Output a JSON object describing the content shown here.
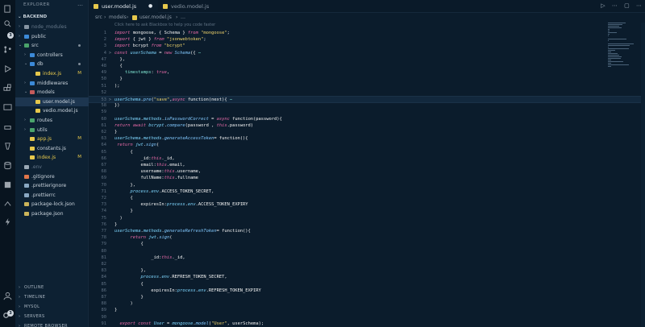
{
  "sidebar": {
    "title": "EXPLORER",
    "title_menu": "…",
    "root": "BACKEND",
    "tree": [
      {
        "label": "node_modules",
        "kind": "folder",
        "depth": 1,
        "chev": "›",
        "color": "gray",
        "dim": true
      },
      {
        "label": "public",
        "kind": "folder",
        "depth": 1,
        "chev": "›",
        "color": "blue"
      },
      {
        "label": "src",
        "kind": "folder",
        "depth": 1,
        "chev": "⌄",
        "color": "green",
        "dot": true
      },
      {
        "label": "controllers",
        "kind": "folder",
        "depth": 2,
        "chev": "›",
        "color": "blue"
      },
      {
        "label": "db",
        "kind": "folder",
        "depth": 2,
        "chev": "⌄",
        "color": "blue",
        "dot": true
      },
      {
        "label": "index.js",
        "kind": "js",
        "depth": 3,
        "mark": "M"
      },
      {
        "label": "middlewares",
        "kind": "folder",
        "depth": 2,
        "chev": "›",
        "color": "blue"
      },
      {
        "label": "models",
        "kind": "folder",
        "depth": 2,
        "chev": "⌄",
        "color": "red"
      },
      {
        "label": "user.model.js",
        "kind": "js",
        "depth": 3,
        "selected": true
      },
      {
        "label": "vedio.model.js",
        "kind": "js",
        "depth": 3
      },
      {
        "label": "routes",
        "kind": "folder",
        "depth": 2,
        "chev": "›",
        "color": "green"
      },
      {
        "label": "utils",
        "kind": "folder",
        "depth": 2,
        "chev": "›",
        "color": "green"
      },
      {
        "label": "app.js",
        "kind": "js",
        "depth": 2,
        "mark": "M"
      },
      {
        "label": "constants.js",
        "kind": "js",
        "depth": 2
      },
      {
        "label": "index.js",
        "kind": "js",
        "depth": 2,
        "mark": "M"
      },
      {
        "label": ".env",
        "kind": "txt",
        "depth": 1,
        "dim": true
      },
      {
        "label": ".gitignore",
        "kind": "git",
        "depth": 1
      },
      {
        "label": ".prettierignore",
        "kind": "prettier",
        "depth": 1
      },
      {
        "label": ".prettierrc",
        "kind": "prettier",
        "depth": 1
      },
      {
        "label": "package-lock.json",
        "kind": "json",
        "depth": 1
      },
      {
        "label": "package.json",
        "kind": "json",
        "depth": 1
      }
    ],
    "panels": [
      "OUTLINE",
      "TIMELINE",
      "MYSQL",
      "SERVERS",
      "REMOTE BROWSER"
    ]
  },
  "tabs": [
    {
      "label": "user.model.js",
      "active": true,
      "marker": "●"
    },
    {
      "label": "vedio.model.js",
      "active": false
    }
  ],
  "editor_actions": [
    "▷",
    "⋯",
    "▢",
    "⋯"
  ],
  "breadcrumb": [
    "src",
    "›",
    "models",
    "›",
    "user.model.js",
    "›",
    "…"
  ],
  "ai_hint": "Click here to ask Blackbox to help you code faster",
  "lines": [
    {
      "n": "1",
      "t": [
        [
          "k",
          "import "
        ],
        [
          "p",
          "mongoose, { Schema } "
        ],
        [
          "k",
          "from "
        ],
        [
          "s",
          "\"mongoose\""
        ],
        [
          "p",
          ";"
        ]
      ]
    },
    {
      "n": "2",
      "t": [
        [
          "k",
          "import "
        ],
        [
          "p",
          "{ jwt } "
        ],
        [
          "k",
          "from "
        ],
        [
          "s",
          "\"jsonwebtoken\""
        ],
        [
          "p",
          ";"
        ]
      ]
    },
    {
      "n": "3",
      "t": [
        [
          "k",
          "import "
        ],
        [
          "p",
          "bcrypt "
        ],
        [
          "k",
          "from "
        ],
        [
          "s",
          "\"bcrypt\""
        ]
      ]
    },
    {
      "n": "4",
      "fold": ">",
      "t": [
        [
          "k",
          "const "
        ],
        [
          "v",
          "userSchema "
        ],
        [
          "p",
          "= "
        ],
        [
          "k",
          "new "
        ],
        [
          "fn",
          "Schema"
        ],
        [
          "p",
          "({"
        ],
        [
          "c",
          " ⋯"
        ]
      ]
    },
    {
      "n": "47",
      "t": [
        [
          "p",
          "  },"
        ]
      ]
    },
    {
      "n": "48",
      "t": [
        [
          "p",
          "  {"
        ]
      ]
    },
    {
      "n": "49",
      "t": [
        [
          "c",
          "    timestamps"
        ],
        [
          "p",
          ": "
        ],
        [
          "k",
          "true"
        ],
        [
          "p",
          ","
        ]
      ]
    },
    {
      "n": "50",
      "t": [
        [
          "p",
          "  }"
        ]
      ]
    },
    {
      "n": "51",
      "t": [
        [
          "p",
          ");"
        ]
      ]
    },
    {
      "n": "52",
      "t": []
    },
    {
      "n": "53",
      "fold": ">",
      "hl": true,
      "t": [
        [
          "v",
          "userSchema"
        ],
        [
          "p",
          "."
        ],
        [
          "fn",
          "pre"
        ],
        [
          "p",
          "("
        ],
        [
          "s",
          "\"save\""
        ],
        [
          "p",
          ","
        ],
        [
          "k",
          "async "
        ],
        [
          "p",
          "function(next){"
        ],
        [
          "c",
          " ⋯"
        ]
      ]
    },
    {
      "n": "58",
      "t": [
        [
          "p",
          "})"
        ]
      ]
    },
    {
      "n": "59",
      "t": []
    },
    {
      "n": "60",
      "t": [
        [
          "v",
          "userSchema"
        ],
        [
          "p",
          "."
        ],
        [
          "v",
          "methods"
        ],
        [
          "p",
          "."
        ],
        [
          "fn",
          "isPasswordCorrect "
        ],
        [
          "p",
          "= "
        ],
        [
          "k",
          "async "
        ],
        [
          "p",
          "function(password){"
        ]
      ]
    },
    {
      "n": "61",
      "t": [
        [
          "k",
          "return "
        ],
        [
          "k",
          "await "
        ],
        [
          "v",
          "bcrypt"
        ],
        [
          "p",
          "."
        ],
        [
          "fn",
          "compare"
        ],
        [
          "p",
          "(password , "
        ],
        [
          "k",
          "this"
        ],
        [
          "p",
          ".password)"
        ]
      ]
    },
    {
      "n": "62",
      "t": [
        [
          "p",
          "}"
        ]
      ]
    },
    {
      "n": "63",
      "t": [
        [
          "v",
          "userSchema"
        ],
        [
          "p",
          "."
        ],
        [
          "v",
          "methods"
        ],
        [
          "p",
          "."
        ],
        [
          "fn",
          "generateAccessToken"
        ],
        [
          "p",
          "= function(){"
        ]
      ]
    },
    {
      "n": "64",
      "t": [
        [
          "k",
          " return "
        ],
        [
          "v",
          "jwt"
        ],
        [
          "p",
          "."
        ],
        [
          "fn",
          "sign"
        ],
        [
          "p",
          "("
        ]
      ]
    },
    {
      "n": "65",
      "t": [
        [
          "p",
          "      {"
        ]
      ]
    },
    {
      "n": "66",
      "t": [
        [
          "p",
          "          _id:"
        ],
        [
          "k",
          "this"
        ],
        [
          "p",
          "._id,"
        ]
      ]
    },
    {
      "n": "67",
      "t": [
        [
          "p",
          "          email:"
        ],
        [
          "k",
          "this"
        ],
        [
          "p",
          ".email,"
        ]
      ]
    },
    {
      "n": "68",
      "t": [
        [
          "p",
          "          username:"
        ],
        [
          "k",
          "this"
        ],
        [
          "p",
          ".username,"
        ]
      ]
    },
    {
      "n": "69",
      "t": [
        [
          "p",
          "          fullName:"
        ],
        [
          "k",
          "this"
        ],
        [
          "p",
          ".fullname"
        ]
      ]
    },
    {
      "n": "70",
      "t": [
        [
          "p",
          "      },"
        ]
      ]
    },
    {
      "n": "71",
      "t": [
        [
          "v",
          "      process"
        ],
        [
          "p",
          "."
        ],
        [
          "v",
          "env"
        ],
        [
          "p",
          ".ACCESS_TOKEN_SECRET,"
        ]
      ]
    },
    {
      "n": "72",
      "t": [
        [
          "p",
          "      {"
        ]
      ]
    },
    {
      "n": "73",
      "t": [
        [
          "p",
          "          expiresIn:"
        ],
        [
          "v",
          "process"
        ],
        [
          "p",
          "."
        ],
        [
          "v",
          "env"
        ],
        [
          "p",
          ".ACCESS_TOKEN_EXPIRY"
        ]
      ]
    },
    {
      "n": "74",
      "t": [
        [
          "p",
          "      }"
        ]
      ]
    },
    {
      "n": "75",
      "t": [
        [
          "p",
          "  )"
        ]
      ]
    },
    {
      "n": "76",
      "t": [
        [
          "p",
          "}"
        ]
      ]
    },
    {
      "n": "77",
      "t": [
        [
          "v",
          "userSchema"
        ],
        [
          "p",
          "."
        ],
        [
          "v",
          "methods"
        ],
        [
          "p",
          "."
        ],
        [
          "fn",
          "generateRefreshToken"
        ],
        [
          "p",
          "= function(){"
        ]
      ]
    },
    {
      "n": "78",
      "t": [
        [
          "k",
          "      return "
        ],
        [
          "v",
          "jwt"
        ],
        [
          "p",
          "."
        ],
        [
          "fn",
          "sign"
        ],
        [
          "p",
          "("
        ]
      ]
    },
    {
      "n": "79",
      "t": [
        [
          "p",
          "          {"
        ]
      ]
    },
    {
      "n": "80",
      "t": []
    },
    {
      "n": "81",
      "t": [
        [
          "p",
          "              _id:"
        ],
        [
          "k",
          "this"
        ],
        [
          "p",
          "._id,"
        ]
      ]
    },
    {
      "n": "82",
      "t": []
    },
    {
      "n": "83",
      "t": [
        [
          "p",
          "          },"
        ]
      ]
    },
    {
      "n": "84",
      "t": [
        [
          "v",
          "          process"
        ],
        [
          "p",
          "."
        ],
        [
          "v",
          "env"
        ],
        [
          "p",
          ".REFRESH_TOKEN_SECRET,"
        ]
      ]
    },
    {
      "n": "85",
      "t": [
        [
          "p",
          "          {"
        ]
      ]
    },
    {
      "n": "86",
      "t": [
        [
          "p",
          "              expiresIn:"
        ],
        [
          "v",
          "process"
        ],
        [
          "p",
          "."
        ],
        [
          "v",
          "env"
        ],
        [
          "p",
          ".REFRESH_TOKEN_EXPIRY"
        ]
      ]
    },
    {
      "n": "87",
      "t": [
        [
          "p",
          "          }"
        ]
      ]
    },
    {
      "n": "88",
      "t": [
        [
          "p",
          "      )"
        ]
      ]
    },
    {
      "n": "89",
      "t": [
        [
          "p",
          "}"
        ]
      ]
    },
    {
      "n": "90",
      "t": []
    },
    {
      "n": "91",
      "t": [
        [
          "k",
          "  export "
        ],
        [
          "k",
          "const "
        ],
        [
          "v",
          "User "
        ],
        [
          "p",
          "= "
        ],
        [
          "v",
          "mongoose"
        ],
        [
          "p",
          "."
        ],
        [
          "fn",
          "model"
        ],
        [
          "p",
          "("
        ],
        [
          "s",
          "\"User\""
        ],
        [
          "p",
          ", userSchema);"
        ]
      ]
    }
  ],
  "colors": {
    "keyword": "#e86aa8",
    "function": "#82c9ff",
    "string": "#f2d56b",
    "background": "#0b1c2c",
    "sidebar": "#0d2133"
  }
}
